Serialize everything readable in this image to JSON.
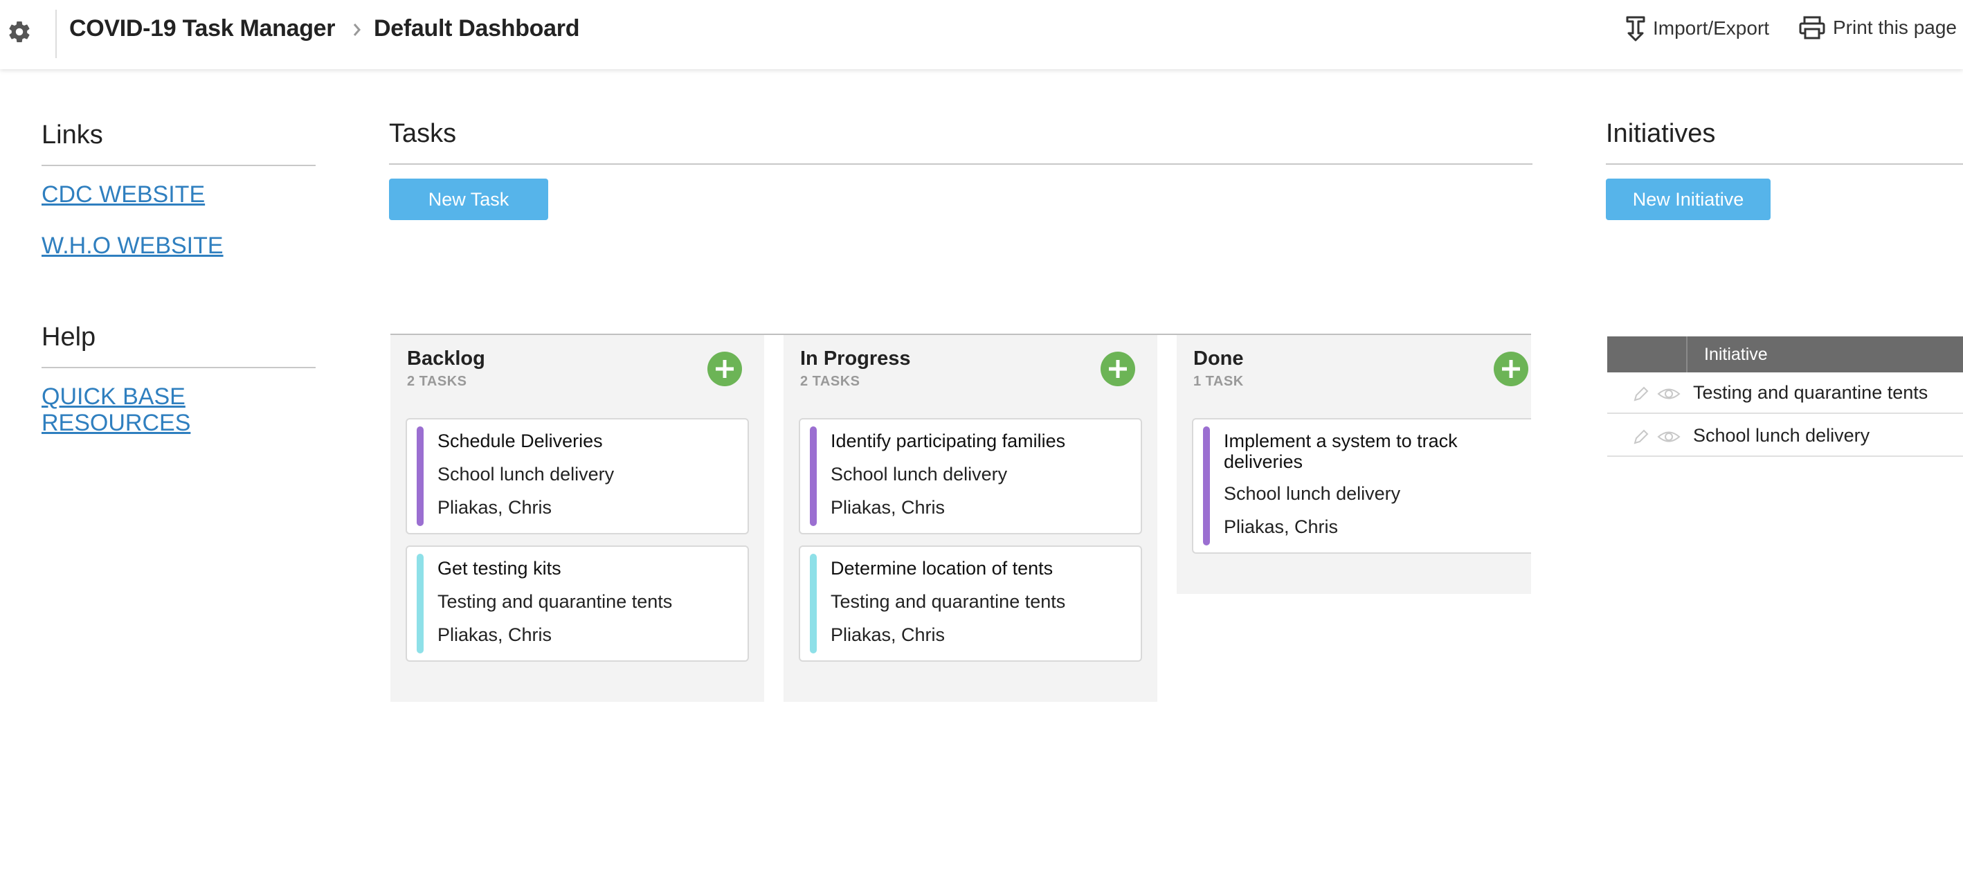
{
  "header": {
    "app_name": "COVID-19 Task Manager",
    "page_name": "Default Dashboard",
    "import_export_label": "Import/Export",
    "print_label": "Print this page"
  },
  "links": {
    "title": "Links",
    "items": [
      "CDC WEBSITE",
      "W.H.O WEBSITE"
    ]
  },
  "help": {
    "title": "Help",
    "items": [
      "QUICK BASE RESOURCES"
    ]
  },
  "tasks": {
    "title": "Tasks",
    "new_button": "New Task",
    "columns": [
      {
        "title": "Backlog",
        "count": "2 TASKS",
        "cards": [
          {
            "title": "Schedule Deliveries",
            "initiative": "School lunch delivery",
            "owner": "Pliakas, Chris",
            "color": "#9b6fd1"
          },
          {
            "title": "Get testing kits",
            "initiative": "Testing and quarantine tents",
            "owner": "Pliakas, Chris",
            "color": "#8ee0e8"
          }
        ]
      },
      {
        "title": "In Progress",
        "count": "2 TASKS",
        "cards": [
          {
            "title": "Identify participating families",
            "initiative": "School lunch delivery",
            "owner": "Pliakas, Chris",
            "color": "#9b6fd1"
          },
          {
            "title": "Determine location of tents",
            "initiative": "Testing and quarantine tents",
            "owner": "Pliakas, Chris",
            "color": "#8ee0e8"
          }
        ]
      },
      {
        "title": "Done",
        "count": "1 TASK",
        "cards": [
          {
            "title": "Implement a system to track deliveries",
            "initiative": "School lunch delivery",
            "owner": "Pliakas, Chris",
            "color": "#9b6fd1"
          }
        ]
      }
    ]
  },
  "initiatives": {
    "title": "Initiatives",
    "new_button": "New Initiative",
    "column_header": "Initiative",
    "rows": [
      "Testing and quarantine tents",
      "School lunch delivery"
    ]
  },
  "icons": {
    "settings": "gear-icon",
    "breadcrumb_separator": "chevron-right-icon",
    "import_export": "import-export-icon",
    "print": "printer-icon",
    "add": "plus-icon",
    "edit": "pencil-icon",
    "view": "eye-icon"
  },
  "colors": {
    "accent_blue": "#56b4ea",
    "link_blue": "#2f7fbf",
    "add_green": "#6cb456",
    "table_header": "#6b6b6b"
  }
}
